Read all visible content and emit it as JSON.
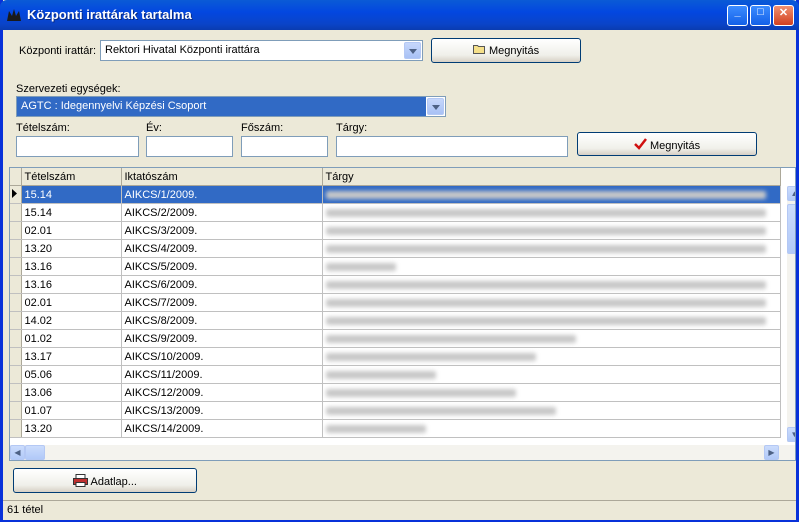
{
  "window": {
    "title": "Központi irattárak tartalma"
  },
  "titlebar_buttons": {
    "minimize": "_",
    "maximize": "□",
    "close": "✕"
  },
  "archive": {
    "label": "Központi irattár:",
    "selected": "Rektori Hivatal Központi irattára",
    "open_button": "Megnyitás"
  },
  "org": {
    "label": "Szervezeti egységek:",
    "selected": "AGTC : Idegennyelvi Képzési Csoport"
  },
  "filters": {
    "tetel_label": "Tételszám:",
    "ev_label": "Év:",
    "foszam_label": "Főszám:",
    "targy_label": "Tárgy:",
    "open_button": "Megnyitás"
  },
  "table": {
    "headers": [
      "Tételszám",
      "Iktatószám",
      "Tárgy"
    ],
    "rows": [
      {
        "tetel": "15.14",
        "iktato": "AIKCS/1/2009.",
        "blur": 440
      },
      {
        "tetel": "15.14",
        "iktato": "AIKCS/2/2009.",
        "blur": 440
      },
      {
        "tetel": "02.01",
        "iktato": "AIKCS/3/2009.",
        "blur": 440
      },
      {
        "tetel": "13.20",
        "iktato": "AIKCS/4/2009.",
        "blur": 440
      },
      {
        "tetel": "13.16",
        "iktato": "AIKCS/5/2009.",
        "blur": 70
      },
      {
        "tetel": "13.16",
        "iktato": "AIKCS/6/2009.",
        "blur": 440
      },
      {
        "tetel": "02.01",
        "iktato": "AIKCS/7/2009.",
        "blur": 440
      },
      {
        "tetel": "14.02",
        "iktato": "AIKCS/8/2009.",
        "blur": 440
      },
      {
        "tetel": "01.02",
        "iktato": "AIKCS/9/2009.",
        "blur": 250
      },
      {
        "tetel": "13.17",
        "iktato": "AIKCS/10/2009.",
        "blur": 210
      },
      {
        "tetel": "05.06",
        "iktato": "AIKCS/11/2009.",
        "blur": 110
      },
      {
        "tetel": "13.06",
        "iktato": "AIKCS/12/2009.",
        "blur": 190
      },
      {
        "tetel": "01.07",
        "iktato": "AIKCS/13/2009.",
        "blur": 230
      },
      {
        "tetel": "13.20",
        "iktato": "AIKCS/14/2009.",
        "blur": 100
      }
    ]
  },
  "adatlap_button": "Adatlap...",
  "status": "61 tétel",
  "colors": {
    "selection": "#316ac5",
    "titlebar": "#0347e0"
  },
  "icons": {
    "open_icon": "folder-icon",
    "check_icon": "checkmark-icon",
    "adatlap_icon": "printer-icon"
  }
}
